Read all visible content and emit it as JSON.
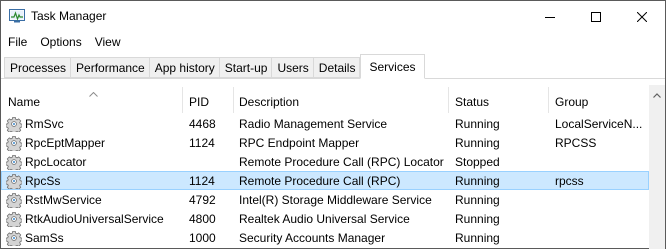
{
  "window": {
    "title": "Task Manager",
    "icon": "task-manager-icon",
    "controls": {
      "minimize": "minimize-icon",
      "maximize": "maximize-icon",
      "close": "close-icon"
    }
  },
  "menu": {
    "items": [
      {
        "label": "File"
      },
      {
        "label": "Options"
      },
      {
        "label": "View"
      }
    ]
  },
  "tabs": {
    "items": [
      {
        "label": "Processes"
      },
      {
        "label": "Performance"
      },
      {
        "label": "App history"
      },
      {
        "label": "Start-up"
      },
      {
        "label": "Users"
      },
      {
        "label": "Details"
      },
      {
        "label": "Services"
      }
    ],
    "active": "Services"
  },
  "table": {
    "columns": {
      "name": "Name",
      "pid": "PID",
      "description": "Description",
      "status": "Status",
      "group": "Group"
    },
    "sorted_by": "Name",
    "rows": [
      {
        "name": "RmSvc",
        "pid": "4468",
        "description": "Radio Management Service",
        "status": "Running",
        "group": "LocalServiceN...",
        "selected": false
      },
      {
        "name": "RpcEptMapper",
        "pid": "1124",
        "description": "RPC Endpoint Mapper",
        "status": "Running",
        "group": "RPCSS",
        "selected": false
      },
      {
        "name": "RpcLocator",
        "pid": "",
        "description": "Remote Procedure Call (RPC) Locator",
        "status": "Stopped",
        "group": "",
        "selected": false
      },
      {
        "name": "RpcSs",
        "pid": "1124",
        "description": "Remote Procedure Call (RPC)",
        "status": "Running",
        "group": "rpcss",
        "selected": true
      },
      {
        "name": "RstMwService",
        "pid": "4792",
        "description": "Intel(R) Storage Middleware Service",
        "status": "Running",
        "group": "",
        "selected": false
      },
      {
        "name": "RtkAudioUniversalService",
        "pid": "4800",
        "description": "Realtek Audio Universal Service",
        "status": "Running",
        "group": "",
        "selected": false
      },
      {
        "name": "SamSs",
        "pid": "1000",
        "description": "Security Accounts Manager",
        "status": "Running",
        "group": "",
        "selected": false
      }
    ]
  },
  "colors": {
    "selection": "#cce8ff",
    "selection_border": "#99d1ff",
    "tab_inactive": "#f0f0f0"
  }
}
